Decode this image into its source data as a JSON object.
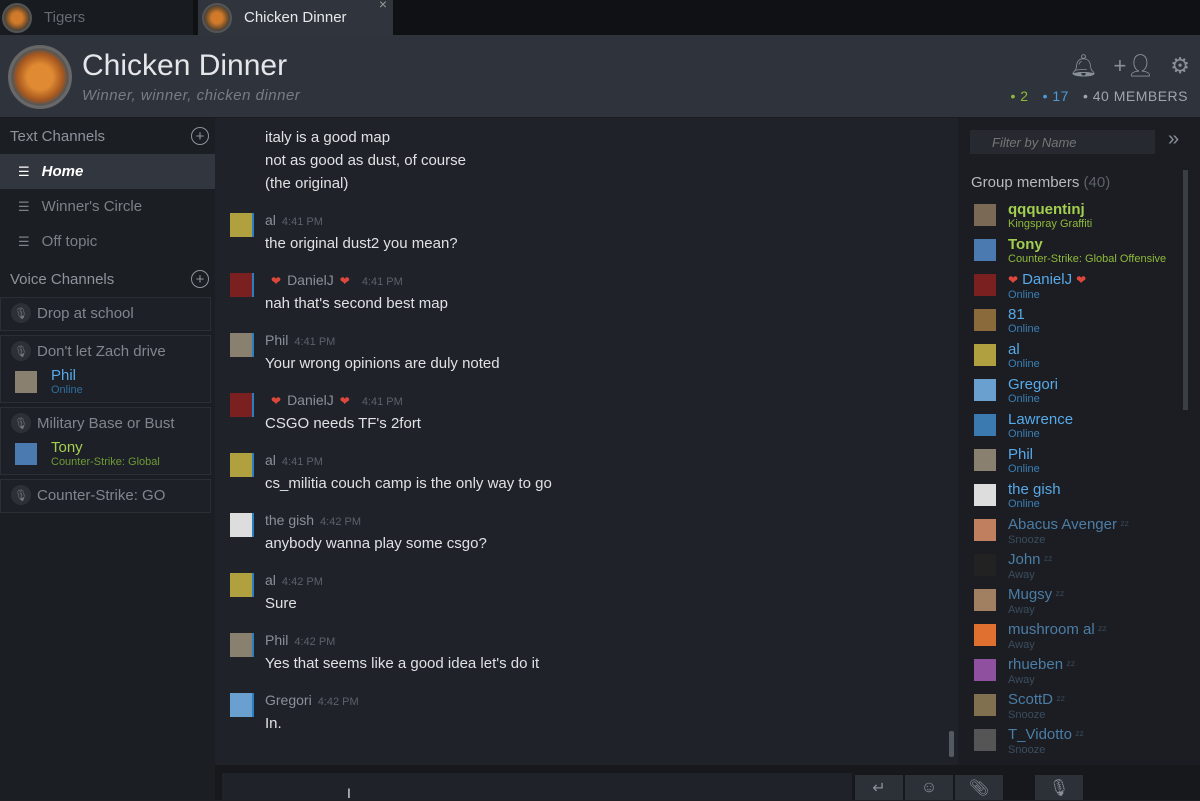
{
  "tabs": [
    {
      "label": "Tigers",
      "active": false
    },
    {
      "label": "Chicken Dinner",
      "active": true
    }
  ],
  "header": {
    "title": "Chicken Dinner",
    "subtitle": "Winner, winner, chicken dinner",
    "counts": {
      "in_game": "2",
      "online": "17",
      "members": "40 MEMBERS"
    }
  },
  "text_channels": {
    "label": "Text Channels",
    "items": [
      "Home",
      "Winner's Circle",
      "Off topic"
    ]
  },
  "voice_channels": {
    "label": "Voice Channels",
    "items": [
      {
        "name": "Drop at school",
        "users": []
      },
      {
        "name": "Don't let Zach drive",
        "users": [
          {
            "name": "Phil",
            "status": "Online"
          }
        ]
      },
      {
        "name": "Military Base or Bust",
        "users": [
          {
            "name": "Tony",
            "status": "Counter-Strike: Global"
          }
        ]
      },
      {
        "name": "Counter-Strike: GO",
        "users": []
      }
    ]
  },
  "messages": [
    {
      "author": "",
      "time": "",
      "lines": [
        "italy is a good map",
        "not as good as dust, of course",
        "(the original)"
      ]
    },
    {
      "author": "al",
      "time": "4:41 PM",
      "lines": [
        "the original dust2 you mean?"
      ]
    },
    {
      "author": "DanielJ",
      "time": "4:41 PM",
      "hearts": true,
      "lines": [
        "nah that's second best map"
      ]
    },
    {
      "author": "Phil",
      "time": "4:41 PM",
      "lines": [
        "Your wrong opinions are duly noted"
      ]
    },
    {
      "author": "DanielJ",
      "time": "4:41 PM",
      "hearts": true,
      "lines": [
        "CSGO needs TF's 2fort"
      ]
    },
    {
      "author": "al",
      "time": "4:41 PM",
      "lines": [
        "cs_militia couch camp is the only way to go"
      ]
    },
    {
      "author": "the gish",
      "time": "4:42 PM",
      "lines": [
        "anybody wanna play some csgo?"
      ]
    },
    {
      "author": "al",
      "time": "4:42 PM",
      "lines": [
        "Sure"
      ]
    },
    {
      "author": "Phil",
      "time": "4:42 PM",
      "lines": [
        "Yes that seems like a good idea let's do it"
      ]
    },
    {
      "author": "Gregori",
      "time": "4:42 PM",
      "lines": [
        "In."
      ]
    }
  ],
  "members": {
    "filter_placeholder": "Filter by Name",
    "label": "Group members",
    "count": "(40)",
    "items": [
      {
        "name": "qqquentinj",
        "status": "Kingspray Graffiti",
        "state": "ingame"
      },
      {
        "name": "Tony",
        "status": "Counter-Strike: Global Offensive",
        "state": "ingame"
      },
      {
        "name": "DanielJ",
        "status": "Online",
        "state": "online",
        "hearts": true
      },
      {
        "name": "81",
        "status": "Online",
        "state": "online"
      },
      {
        "name": "al",
        "status": "Online",
        "state": "online"
      },
      {
        "name": "Gregori",
        "status": "Online",
        "state": "online"
      },
      {
        "name": "Lawrence",
        "status": "Online",
        "state": "online"
      },
      {
        "name": "Phil",
        "status": "Online",
        "state": "online"
      },
      {
        "name": "the gish",
        "status": "Online",
        "state": "online"
      },
      {
        "name": "Abacus Avenger",
        "status": "Snooze",
        "state": "away"
      },
      {
        "name": "John",
        "status": "Away",
        "state": "away"
      },
      {
        "name": "Mugsy",
        "status": "Away",
        "state": "away"
      },
      {
        "name": "mushroom al",
        "status": "Away",
        "state": "away"
      },
      {
        "name": "rhueben",
        "status": "Away",
        "state": "away"
      },
      {
        "name": "ScottD",
        "status": "Snooze",
        "state": "away"
      },
      {
        "name": "T_Vidotto",
        "status": "Snooze",
        "state": "away"
      }
    ]
  },
  "colors": {
    "ingame": "#a3cf4f",
    "online": "#57a9e8",
    "away": "#4b7da6",
    "accent": "#2a7fc0"
  }
}
